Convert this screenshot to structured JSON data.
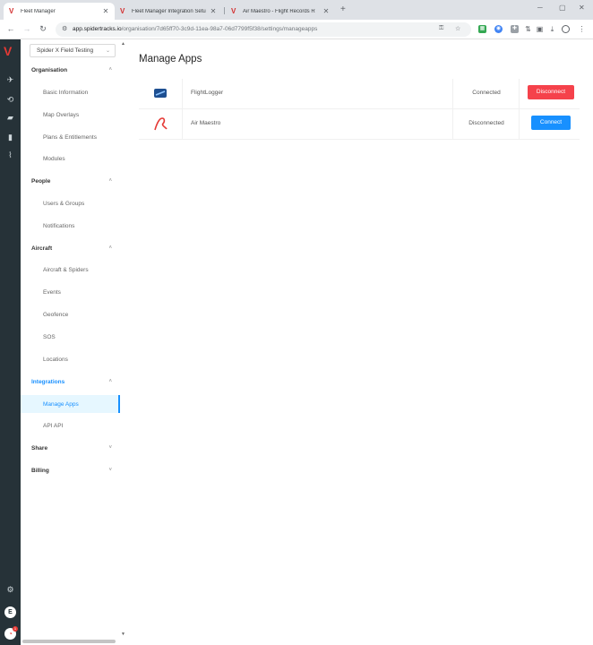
{
  "browser": {
    "tabs": [
      {
        "title": "Fleet Manager",
        "active": true
      },
      {
        "title": "Fleet Manager Integration Setu",
        "active": false
      },
      {
        "title": "Air Maestro - Flight Records R",
        "active": false
      }
    ],
    "url_host": "app.spidertracks.io",
    "url_path": "/organisation/7d65ff70-3c9d-11ea-98a7-06d7799f5f38/settings/manageapps"
  },
  "sidebar": {
    "org": "Spider X Field Testing",
    "sections": [
      {
        "label": "Organisation",
        "items": [
          "Basic Information",
          "Map Overlays",
          "Plans & Entitlements",
          "Modules"
        ]
      },
      {
        "label": "People",
        "items": [
          "Users & Groups",
          "Notifications"
        ]
      },
      {
        "label": "Aircraft",
        "items": [
          "Aircraft & Spiders",
          "Events",
          "Geofence",
          "SOS",
          "Locations"
        ]
      },
      {
        "label": "Integrations",
        "items": [
          "Manage Apps",
          "API API"
        ]
      },
      {
        "label": "Share",
        "items": []
      },
      {
        "label": "Billing",
        "items": []
      }
    ],
    "active_item": "Manage Apps"
  },
  "rail": {
    "avatar_initial": "E",
    "notif_count": "1"
  },
  "main": {
    "title": "Manage Apps",
    "apps": [
      {
        "name": "FlightLogger",
        "status": "Connected",
        "action": "Disconnect",
        "action_color": "#f5424b"
      },
      {
        "name": "Air Maestro",
        "status": "Disconnected",
        "action": "Connect",
        "action_color": "#1890ff"
      }
    ]
  },
  "colors": {
    "accent": "#1890ff",
    "danger": "#f5424b",
    "rail": "#263238",
    "brand": "#e53935"
  }
}
